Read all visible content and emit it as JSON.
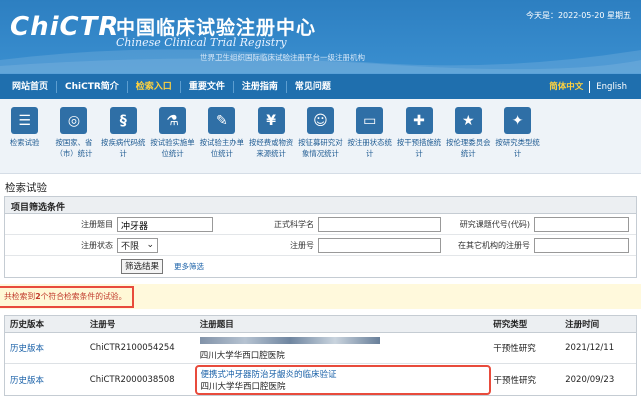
{
  "header": {
    "logo": "ChiCTR",
    "cn_title": "中国临床试验注册中心",
    "en_title": "Chinese Clinical Trial Registry",
    "subtitle": "世界卫生组织国际临床试验注册平台一级注册机构",
    "date": "今天是：2022-05-20 星期五"
  },
  "nav": {
    "items": [
      "网站首页",
      "ChiCTR简介",
      "检索入口",
      "重要文件",
      "注册指南",
      "常见问题"
    ],
    "active_index": 2,
    "lang_zh": "简体中文",
    "lang_en": "English"
  },
  "icons": [
    {
      "glyph": "☰",
      "name": "list-icon",
      "label": "检索试验"
    },
    {
      "glyph": "◎",
      "name": "globe-icon",
      "label": "按国家、省（市）统计"
    },
    {
      "glyph": "§",
      "name": "dna-icon",
      "label": "按疾病代码统计"
    },
    {
      "glyph": "⚗",
      "name": "flask-icon",
      "label": "按试验实施单位统计"
    },
    {
      "glyph": "✎",
      "name": "clipboard-icon",
      "label": "按试验主办单位统计"
    },
    {
      "glyph": "¥",
      "name": "money-icon",
      "label": "按经费或物资来源统计"
    },
    {
      "glyph": "☺",
      "name": "people-icon",
      "label": "按征募研究对象情况统计"
    },
    {
      "glyph": "▭",
      "name": "card-icon",
      "label": "按注册状态统计"
    },
    {
      "glyph": "✚",
      "name": "doctor-icon",
      "label": "按干预措施统计"
    },
    {
      "glyph": "★",
      "name": "star-icon",
      "label": "按伦理委员会统计"
    },
    {
      "glyph": "✦",
      "name": "sparkle-icon",
      "label": "按研究类型统计"
    }
  ],
  "section_title": "检索试验",
  "filter": {
    "heading": "项目筛选条件",
    "title_label": "注册题目",
    "title_value": "冲牙器",
    "sci_title_label": "正式科学名",
    "code_label": "研究课题代号(代码)",
    "status_label": "注册状态",
    "status_value": "不限",
    "regno_label": "注册号",
    "other_regno_label": "在其它机构的注册号",
    "submit_label": "筛选结果",
    "more_label": "更多筛选"
  },
  "notice": {
    "prefix": "共检索到",
    "count": "2",
    "suffix": "个符合检索条件的试验。"
  },
  "results": {
    "headers": [
      "历史版本",
      "注册号",
      "注册题目",
      "研究类型",
      "注册时间"
    ],
    "rows": [
      {
        "history": "历史版本",
        "regno": "ChiCTR2100054254",
        "title": "",
        "org": "四川大学华西口腔医院",
        "type": "干预性研究",
        "date": "2021/12/11"
      },
      {
        "history": "历史版本",
        "regno": "ChiCTR2000038508",
        "title": "便携式冲牙器防治牙龈炎的临床验证",
        "org": "四川大学华西口腔医院",
        "type": "干预性研究",
        "date": "2020/09/23"
      }
    ]
  },
  "colors": {
    "header_blue": "#2d7fc1",
    "nav_blue": "#1f6fae",
    "icon_blue": "#2f6fa6",
    "highlight_red": "#e84b3c",
    "link_blue": "#1a61a8"
  }
}
